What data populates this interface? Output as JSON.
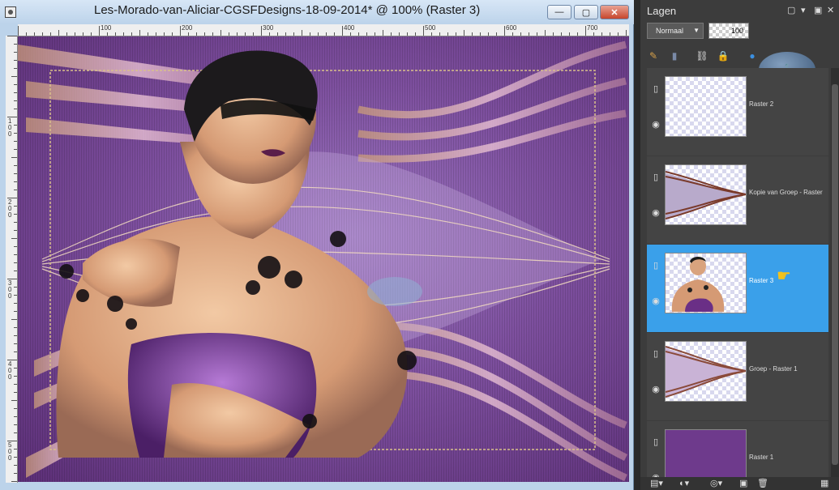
{
  "document": {
    "title": "Les-Morado-van-Aliciar-CGSFDesigns-18-09-2014* @ 100% (Raster 3)",
    "controls": {
      "minimize": "—",
      "maximize": "▢",
      "close": "✕"
    },
    "ruler_top": [
      "100",
      "200",
      "300",
      "400",
      "500",
      "600",
      "700"
    ],
    "ruler_left": [
      "1\n0\n0",
      "2\n0\n0",
      "3\n0\n0",
      "4\n0\n0",
      "5\n0\n0"
    ]
  },
  "layers_panel": {
    "title": "Lagen",
    "blend_mode": "Normaal",
    "opacity": "100",
    "layers": [
      {
        "name": "Raster 2",
        "thumb": "transparent",
        "selected": false
      },
      {
        "name": "Kopie van Groep - Raster",
        "thumb": "wave",
        "selected": false
      },
      {
        "name": "Raster 3",
        "thumb": "woman",
        "selected": true
      },
      {
        "name": "Groep - Raster 1",
        "thumb": "wave",
        "selected": false
      },
      {
        "name": "Raster 1",
        "thumb": "solid-purple",
        "selected": false
      }
    ]
  },
  "colors": {
    "selection": "#3aa0ea",
    "panel_bg": "#3c3c3c",
    "canvas_purple": "#7d4f9e"
  }
}
